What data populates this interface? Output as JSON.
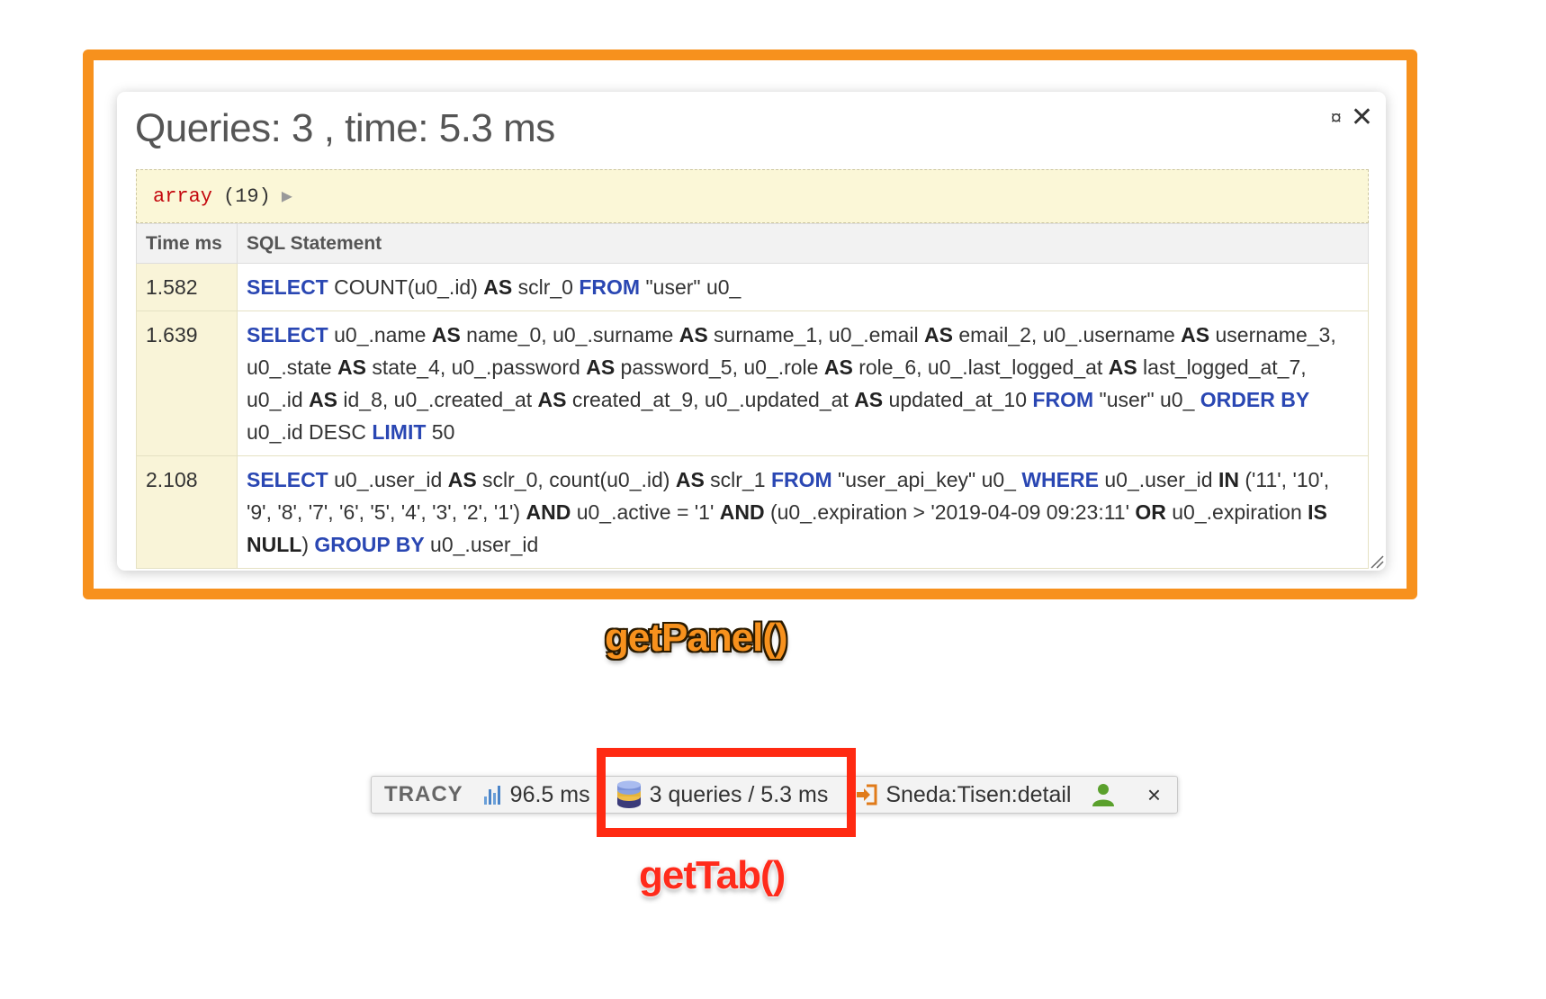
{
  "panel": {
    "title": "Queries: 3 , time: 5.3 ms",
    "window_icon": "window-toggle-icon",
    "close_icon": "close-icon",
    "dump": {
      "type": "array",
      "count": "(19)",
      "toggle": "▶"
    },
    "table": {
      "headers": [
        "Time ms",
        "SQL Statement"
      ],
      "rows": [
        {
          "time": "1.582",
          "sql": "SELECT COUNT(u0_.id) AS sclr_0 FROM \"user\" u0_"
        },
        {
          "time": "1.639",
          "sql": "SELECT u0_.name AS name_0, u0_.surname AS surname_1, u0_.email AS email_2, u0_.username AS username_3, u0_.state AS state_4, u0_.password AS password_5, u0_.role AS role_6, u0_.last_logged_at AS last_logged_at_7, u0_.id AS id_8, u0_.created_at AS created_at_9, u0_.updated_at AS updated_at_10 FROM \"user\" u0_ ORDER BY u0_.id DESC LIMIT 50"
        },
        {
          "time": "2.108",
          "sql": "SELECT u0_.user_id AS sclr_0, count(u0_.id) AS sclr_1 FROM \"user_api_key\" u0_ WHERE u0_.user_id IN ('11', '10', '9', '8', '7', '6', '5', '4', '3', '2', '1') AND u0_.active = '1' AND (u0_.expiration > '2019-04-09 09:23:11' OR u0_.expiration IS NULL) GROUP BY u0_.user_id"
        }
      ]
    }
  },
  "callouts": {
    "panel": "getPanel()",
    "tab": "getTab()"
  },
  "tracy_bar": {
    "logo": "TRACY",
    "timer": {
      "icon": "bar-chart-icon",
      "label": "96.5 ms"
    },
    "queries": {
      "icon": "database-icon",
      "label": "3 queries / 5.3 ms"
    },
    "presenter": {
      "icon": "login-arrow-icon",
      "label": "Sneda:Tisen:detail"
    },
    "user": {
      "icon": "user-icon"
    },
    "close": "×"
  },
  "colors": {
    "panel_frame": "#f7911d",
    "tab_frame": "#ff2a12",
    "sql_keyword": "#2a47b3"
  }
}
